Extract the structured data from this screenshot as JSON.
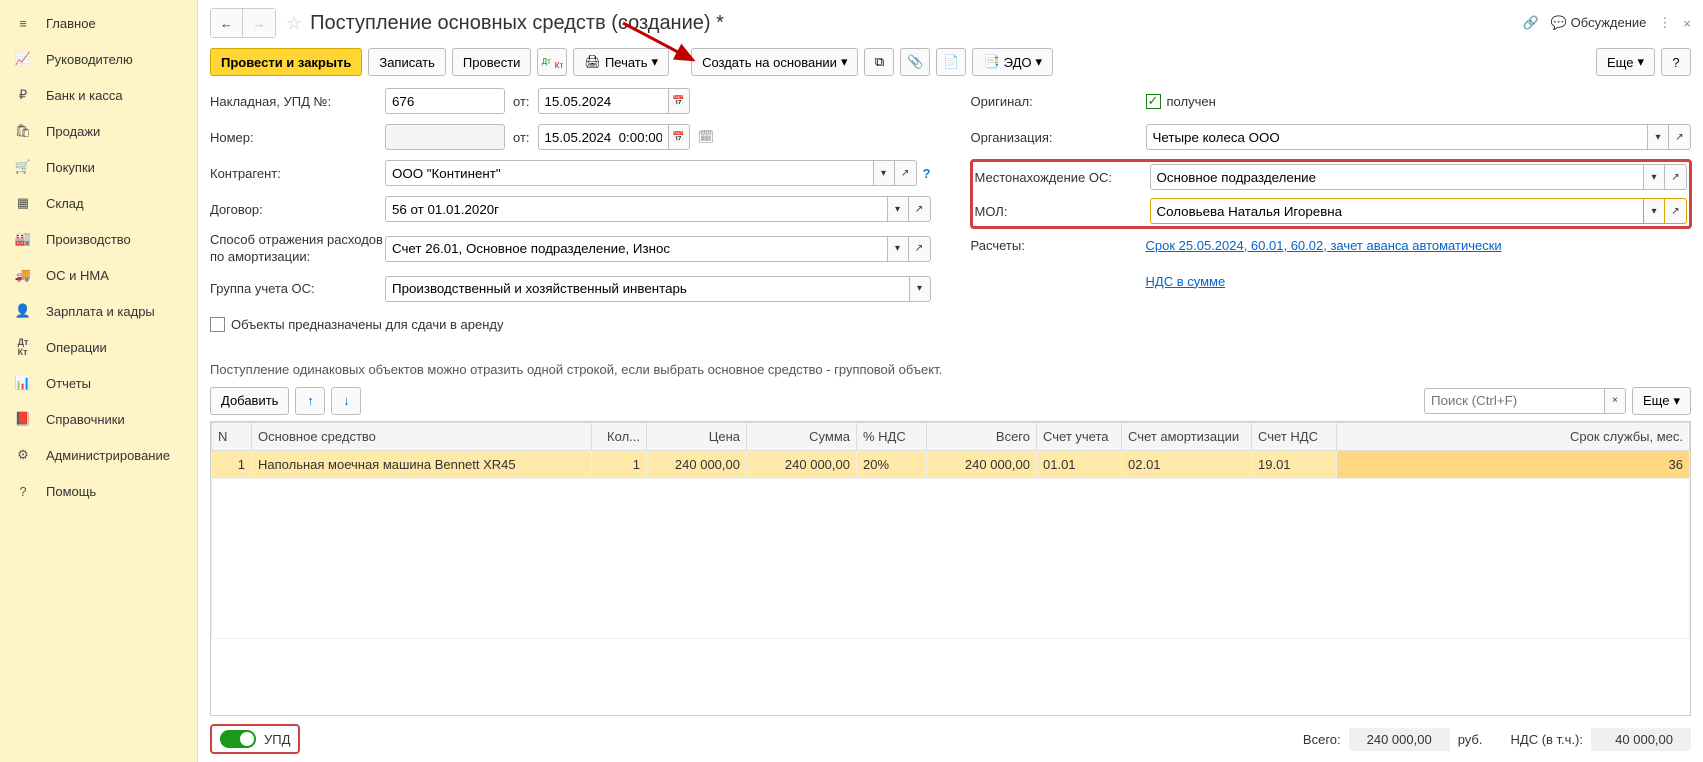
{
  "sidebar": {
    "items": [
      {
        "icon": "menu",
        "label": "Главное"
      },
      {
        "icon": "trend",
        "label": "Руководителю"
      },
      {
        "icon": "ruble",
        "label": "Банк и касса"
      },
      {
        "icon": "bag",
        "label": "Продажи"
      },
      {
        "icon": "cart",
        "label": "Покупки"
      },
      {
        "icon": "grid",
        "label": "Склад"
      },
      {
        "icon": "factory",
        "label": "Производство"
      },
      {
        "icon": "truck",
        "label": "ОС и НМА"
      },
      {
        "icon": "person",
        "label": "Зарплата и кадры"
      },
      {
        "icon": "dk",
        "label": "Операции"
      },
      {
        "icon": "bars",
        "label": "Отчеты"
      },
      {
        "icon": "book",
        "label": "Справочники"
      },
      {
        "icon": "gear",
        "label": "Администрирование"
      },
      {
        "icon": "help",
        "label": "Помощь"
      }
    ]
  },
  "title": "Поступление основных средств (создание) *",
  "titlebar": {
    "discuss": "Обсуждение"
  },
  "toolbar": {
    "post_close": "Провести и закрыть",
    "save": "Записать",
    "post": "Провести",
    "print": "Печать",
    "create_based": "Создать на основании",
    "edo": "ЭДО",
    "more": "Еще"
  },
  "form": {
    "invoice_label": "Накладная, УПД №:",
    "invoice_no": "676",
    "from": "от:",
    "invoice_date": "15.05.2024",
    "number_label": "Номер:",
    "number": "",
    "doc_date": "15.05.2024  0:00:00",
    "counterparty_label": "Контрагент:",
    "counterparty": "ООО \"Континент\"",
    "contract_label": "Договор:",
    "contract": "56 от 01.01.2020г",
    "expense_label": "Способ отражения расходов по амортизации:",
    "expense": "Счет 26.01, Основное подразделение, Износ",
    "group_label": "Группа учета ОС:",
    "group": "Производственный и хозяйственный инвентарь",
    "rent_checkbox": "Объекты предназначены для сдачи в аренду",
    "original_label": "Оригинал:",
    "received": "получен",
    "org_label": "Организация:",
    "org": "Четыре колеса ООО",
    "location_label": "Местонахождение ОС:",
    "location": "Основное подразделение",
    "mol_label": "МОЛ:",
    "mol": "Соловьева Наталья Игоревна",
    "calc_label": "Расчеты:",
    "calc_link": "Срок 25.05.2024, 60.01, 60.02, зачет аванса автоматически",
    "vat_link": "НДС в сумме"
  },
  "hint": "Поступление одинаковых объектов можно отразить одной строкой, если выбрать основное средство - групповой объект.",
  "table_toolbar": {
    "add": "Добавить",
    "search_placeholder": "Поиск (Ctrl+F)",
    "more": "Еще"
  },
  "table": {
    "headers": [
      "N",
      "Основное средство",
      "Кол...",
      "Цена",
      "Сумма",
      "% НДС",
      "Всего",
      "Счет учета",
      "Счет амортизации",
      "Счет НДС",
      "Срок службы, мес."
    ],
    "rows": [
      {
        "n": "1",
        "name": "Напольная моечная машина Bennett XR45",
        "qty": "1",
        "price": "240 000,00",
        "sum": "240 000,00",
        "vat": "20%",
        "total": "240 000,00",
        "acc": "01.01",
        "amort": "02.01",
        "vat_acc": "19.01",
        "life": "36"
      }
    ]
  },
  "footer": {
    "upd": "УПД",
    "total_label": "Всего:",
    "total": "240 000,00",
    "currency": "руб.",
    "vat_label": "НДС (в т.ч.):",
    "vat": "40 000,00"
  }
}
